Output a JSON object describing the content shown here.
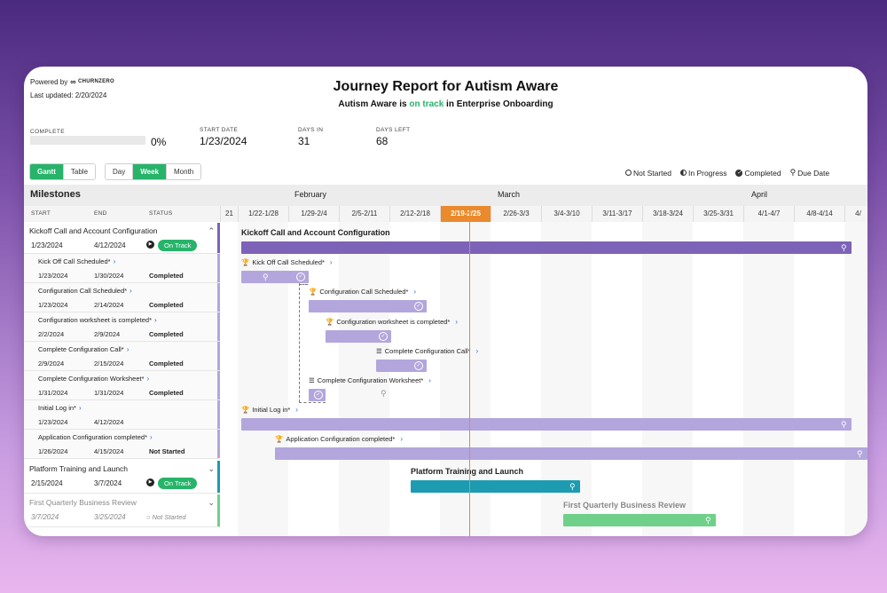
{
  "header": {
    "powered_by": "Powered by",
    "brand": "CHURNZERO",
    "last_updated": "Last updated: 2/20/2024",
    "title": "Journey Report for Autism Aware",
    "subtitle_pre": "Autism Aware is ",
    "subtitle_status": "on track",
    "subtitle_post": " in Enterprise Onboarding"
  },
  "stats": {
    "complete_label": "COMPLETE",
    "complete_value": "0%",
    "complete_fraction": 0,
    "start_label": "START DATE",
    "start_value": "1/23/2024",
    "days_in_label": "DAYS IN",
    "days_in_value": "31",
    "days_left_label": "DAYS LEFT",
    "days_left_value": "68"
  },
  "view_toggle": {
    "gantt": "Gantt",
    "table": "Table"
  },
  "scale_toggle": {
    "day": "Day",
    "week": "Week",
    "month": "Month"
  },
  "legend": {
    "not_started": "Not Started",
    "in_progress": "In Progress",
    "completed": "Completed",
    "due_date": "Due Date"
  },
  "milestones": {
    "title": "Milestones",
    "col_start": "START",
    "col_end": "END",
    "col_status": "STATUS"
  },
  "rows": [
    {
      "name": "Kickoff Call and Account Configuration",
      "start": "1/23/2024",
      "end": "4/12/2024",
      "status": "On Track"
    },
    {
      "name": "Kick Off Call Scheduled*",
      "start": "1/23/2024",
      "end": "1/30/2024",
      "status": "Completed"
    },
    {
      "name": "Configuration Call Scheduled*",
      "start": "1/23/2024",
      "end": "2/14/2024",
      "status": "Completed"
    },
    {
      "name": "Configuration worksheet is completed*",
      "start": "2/2/2024",
      "end": "2/9/2024",
      "status": "Completed"
    },
    {
      "name": "Complete Configuration Call*",
      "start": "2/9/2024",
      "end": "2/15/2024",
      "status": "Completed"
    },
    {
      "name": "Complete Configuration Worksheet*",
      "start": "1/31/2024",
      "end": "1/31/2024",
      "status": "Completed"
    },
    {
      "name": "Initial Log in*",
      "start": "1/23/2024",
      "end": "4/12/2024",
      "status": ""
    },
    {
      "name": "Application Configuration completed*",
      "start": "1/26/2024",
      "end": "4/15/2024",
      "status": "Not Started"
    },
    {
      "name": "Platform Training and Launch",
      "start": "2/15/2024",
      "end": "3/7/2024",
      "status": "On Track"
    },
    {
      "name": "First Quarterly Business Review",
      "start": "3/7/2024",
      "end": "3/25/2024",
      "status": "Not Started"
    }
  ],
  "timeline": {
    "months": [
      "February",
      "March",
      "April"
    ],
    "weeks": [
      "21",
      "1/22-1/28",
      "1/29-2/4",
      "2/5-2/11",
      "2/12-2/18",
      "2/19-2/25",
      "2/26-3/3",
      "3/4-3/10",
      "3/11-3/17",
      "3/18-3/24",
      "3/25-3/31",
      "4/1-4/7",
      "4/8-4/14",
      "4/"
    ],
    "current_week": "2/19-2/25"
  },
  "colors": {
    "accent_green": "#27b36a",
    "kickoff_purple": "#7c63b8",
    "light_purple": "#b3a6dc",
    "teal": "#1d9bb0",
    "green_bar": "#6fd08a",
    "today": "#ea8a2c"
  }
}
